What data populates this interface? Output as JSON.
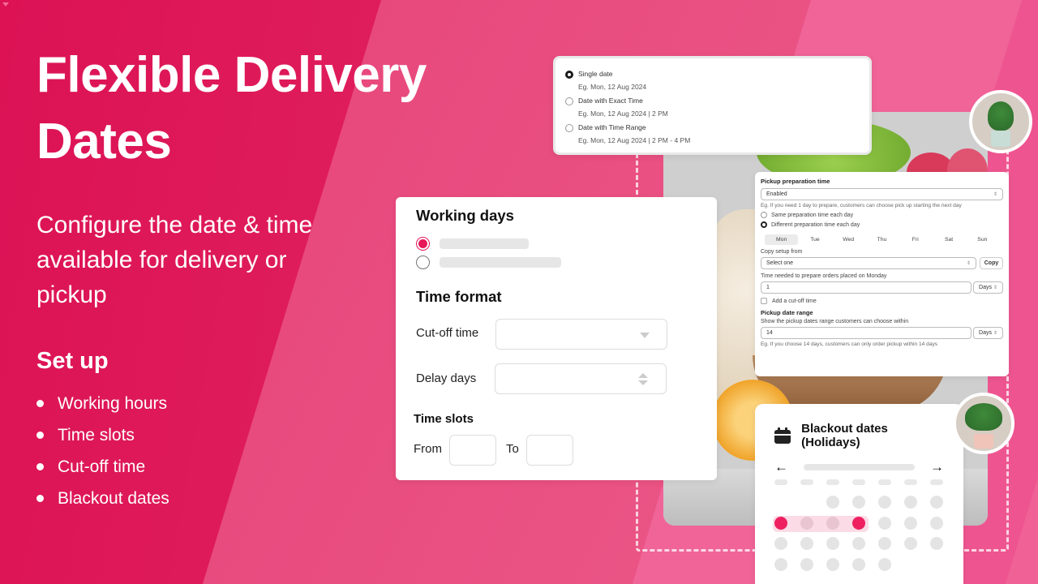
{
  "hero": {
    "title": "Flexible Delivery Dates",
    "subtitle": "Configure the date & time available for delivery or pickup",
    "setup_heading": "Set up",
    "setup_items": [
      "Working hours",
      "Time slots",
      "Cut-off time",
      "Blackout dates"
    ]
  },
  "date_format_card": {
    "options": [
      {
        "label": "Single date",
        "example": "Eg. Mon, 12 Aug 2024",
        "selected": true
      },
      {
        "label": "Date with Exact Time",
        "example": "Eg. Mon, 12 Aug 2024 | 2 PM",
        "selected": false
      },
      {
        "label": "Date with Time Range",
        "example": "Eg. Mon, 12 Aug 2024 | 2 PM - 4 PM",
        "selected": false
      }
    ]
  },
  "working_card": {
    "working_days_heading": "Working days",
    "time_format_heading": "Time format",
    "cutoff_label": "Cut-off time",
    "delay_label": "Delay days",
    "time_slots_heading": "Time slots",
    "from_label": "From",
    "to_label": "To"
  },
  "pickup_card": {
    "heading": "Pickup preparation time",
    "status_value": "Enabled",
    "status_help": "Eg. If you need 1 day to prepare, customers can choose pick up starting the next day",
    "radio_same": "Same preparation time each day",
    "radio_different": "Different preparation time each day",
    "days": [
      "Mon",
      "Tue",
      "Wed",
      "Thu",
      "Fri",
      "Sat",
      "Sun"
    ],
    "active_day": "Mon",
    "copy_label": "Copy setup from",
    "copy_select": "Select one",
    "copy_button": "Copy",
    "time_needed_label": "Time needed to prepare orders placed on Monday",
    "time_needed_value": "1",
    "time_unit": "Days",
    "cutoff_checkbox": "Add a cut-off time",
    "range_heading": "Pickup date range",
    "range_label": "Show the pickup dates range customers can choose within",
    "range_value": "14",
    "range_unit": "Days",
    "range_help": "Eg. If you choose 14 days, customers can only order pickup within 14 days"
  },
  "blackout_card": {
    "title": "Blackout dates (Holidays)",
    "prev_arrow": "←",
    "next_arrow": "→"
  },
  "colors": {
    "accent": "#e8185a",
    "selected_range": "#fbdbe6"
  }
}
